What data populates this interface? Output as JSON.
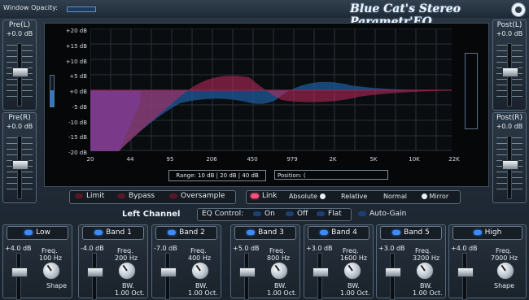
{
  "window": {
    "opacity_label": "Window Opacity:",
    "opacity_value": 0.55
  },
  "title": "Blue Cat's Stereo Parametr'EQ",
  "pre_left": {
    "label": "Pre(L)",
    "value": "+0.0 dB"
  },
  "pre_right": {
    "label": "Pre(R)",
    "value": "+0.0 dB"
  },
  "post_left": {
    "label": "Post(L)",
    "value": "+0.0 dB"
  },
  "post_right": {
    "label": "Post(R)",
    "value": "+0.0 dB"
  },
  "graph": {
    "y_labels": [
      "+20 dB",
      "+15 dB",
      "+10 dB",
      "+5 dB",
      "+0 dB",
      "-5 dB",
      "-10 dB",
      "-15 dB",
      "-20 dB"
    ],
    "x_labels": [
      "20",
      "44",
      "95",
      "206",
      "450",
      "979",
      "2K",
      "5K",
      "10K",
      "22K"
    ],
    "range_text": "Range:  10 dB  |  20 dB  |  40 dB",
    "position_text": "Position:  (",
    "curve_colors": {
      "left": "#c42a5f",
      "right": "#1e5a9a",
      "shelf": "#7b3a8f"
    }
  },
  "controls": {
    "limit": "Limit",
    "bypass": "Bypass",
    "oversample": "Oversample",
    "link": "Link",
    "absolute": "Absolute",
    "relative": "Relative",
    "normal": "Normal",
    "mirror": "Mirror"
  },
  "channel_label": "Left Channel",
  "eq_control": {
    "label": "EQ Control:",
    "on": "On",
    "off": "Off",
    "flat": "Flat"
  },
  "auto_gain": "Auto-Gain",
  "bands": [
    {
      "name": "Low",
      "gain": "+4.0 dB",
      "freq_label": "Freq.",
      "freq": "100 Hz",
      "bw_label": "Shape",
      "bw": ""
    },
    {
      "name": "Band 1",
      "gain": "-4.0 dB",
      "freq_label": "Freq.",
      "freq": "200 Hz",
      "bw_label": "BW.",
      "bw": "1.00 Oct."
    },
    {
      "name": "Band 2",
      "gain": "-7.0 dB",
      "freq_label": "Freq.",
      "freq": "400 Hz",
      "bw_label": "BW.",
      "bw": "1.00 Oct."
    },
    {
      "name": "Band 3",
      "gain": "+5.0 dB",
      "freq_label": "Freq.",
      "freq": "800 Hz",
      "bw_label": "BW.",
      "bw": "1.00 Oct."
    },
    {
      "name": "Band 4",
      "gain": "+3.0 dB",
      "freq_label": "Freq.",
      "freq": "1600 Hz",
      "bw_label": "BW.",
      "bw": "1.00 Oct."
    },
    {
      "name": "Band 5",
      "gain": "+3.0 dB",
      "freq_label": "Freq.",
      "freq": "3200 Hz",
      "bw_label": "BW.",
      "bw": "1.00 Oct."
    },
    {
      "name": "High",
      "gain": "+4.0 dB",
      "freq_label": "Freq.",
      "freq": "7000 Hz",
      "bw_label": "Shape",
      "bw": ""
    }
  ]
}
